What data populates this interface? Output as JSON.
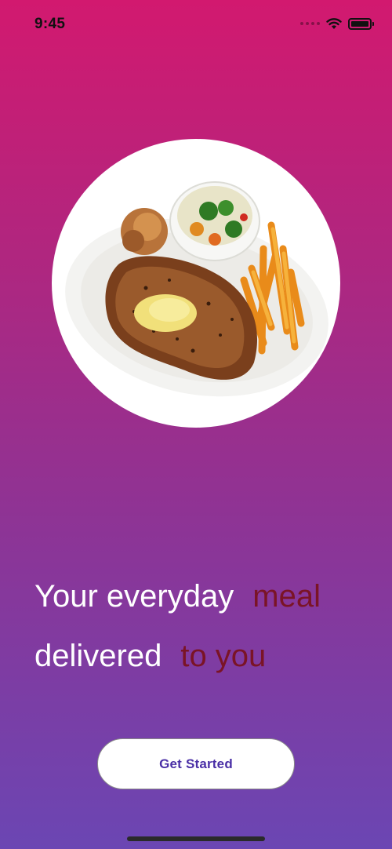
{
  "status_bar": {
    "time": "9:45",
    "icons": [
      "signal-icon",
      "wifi-icon",
      "battery-icon"
    ]
  },
  "hero_image": {
    "description_icon": "steak-plate-image"
  },
  "headline": {
    "line1_main": "Your everyday",
    "line1_accent": "meal",
    "line2_main": "delivered",
    "line2_accent": "to you"
  },
  "cta": {
    "label": "Get Started"
  },
  "colors": {
    "gradient_top": "#d2196f",
    "gradient_bottom": "#6b46b3",
    "accent_text": "#7a1426",
    "button_text": "#4a2fa6"
  }
}
